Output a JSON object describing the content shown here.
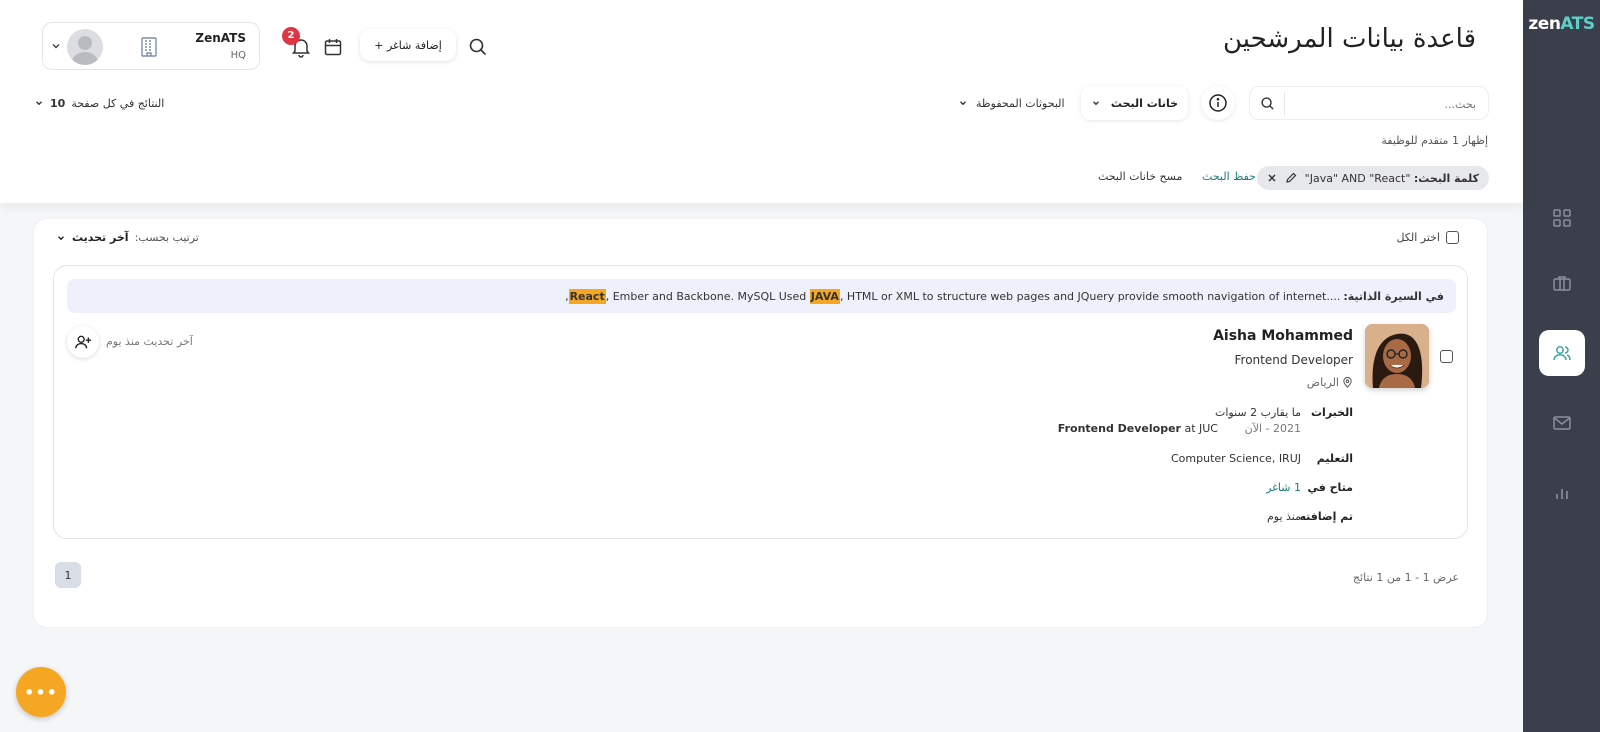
{
  "app": {
    "logo_text": "zen",
    "logo_accent": "ATS"
  },
  "header": {
    "title": "قاعدة بيانات المرشحين",
    "add_vacancy_label": "+ إضافة شاغر",
    "notification_count": "2",
    "org_name": "ZenATS",
    "org_branch": "HQ"
  },
  "search": {
    "placeholder": "بحث...",
    "fields_label": "خانات البحث",
    "saved_label": "البحوثات المحفوظة",
    "per_page_label": "النتائج في كل صفحة",
    "per_page_value": "10",
    "showing_text": "إظهار 1 متقدم للوظيفة",
    "keyword_label": "كلمة البحث:",
    "keyword_value": "\"Java\" AND \"React\"",
    "save_search_label": "حفظ البحث",
    "clear_fields_label": "مسح خانات البحث"
  },
  "list": {
    "select_all_label": "اختر الكل",
    "sort_label": "ترتيب بحسب:",
    "sort_value": "آخر تحديث"
  },
  "candidate": {
    "snippet_label": "في السيرة الذاتية:",
    "snippet_prefix": "...",
    "snippet_part1": "Ember and Backbone. MySQL Used ",
    "snippet_hl1": "JAVA",
    "snippet_part2": ", HTML or XML to structure web pages and JQuery provide smooth navigation of internet.",
    "snippet_hl2": "React",
    "snippet_part0": ", ",
    "snippet_end": ",",
    "name": "Aisha Mohammed",
    "title": "Frontend Developer",
    "location": "الرياض",
    "last_update": "آخر تحديث منذ يوم",
    "experience_label": "الخبرات",
    "experience_duration": "ما يقارب 2 سنوات",
    "experience_period": "2021 - الآن",
    "experience_role": "Frontend Developer",
    "experience_company": " at JUC",
    "education_label": "التعليم",
    "education_value": "Computer Science, IRUJ",
    "available_label": "متاح في",
    "available_value": "1 شاغر",
    "added_label": "تم إضافته",
    "added_value": "منذ يوم"
  },
  "pagination": {
    "results_text": "عرض 1 - 1 من 1 نتائج",
    "current_page": "1"
  },
  "fab": {
    "label": "•••"
  },
  "colors": {
    "accent": "#f5a623",
    "teal": "#177f7a",
    "sidebar": "#3a3f4b",
    "badge": "#e03542"
  }
}
